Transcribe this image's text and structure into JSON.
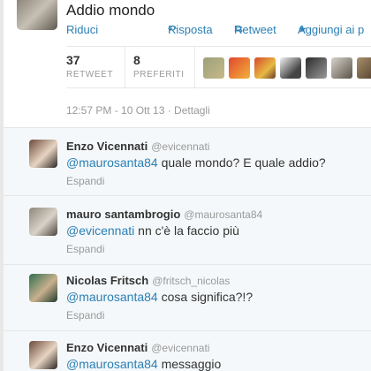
{
  "main_tweet": {
    "text": "Addio mondo",
    "actions": {
      "collapse": "Riduci",
      "reply": "Risposta",
      "retweet": "Retweet",
      "favorite": "Aggiungi ai p"
    },
    "stats": {
      "retweets": {
        "count": "37",
        "label": "RETWEET"
      },
      "favorites": {
        "count": "8",
        "label": "PREFERITI"
      }
    },
    "timestamp": "12:57 PM - 10 Ott 13 · Dettagli"
  },
  "replies": [
    {
      "name": "Enzo Vicennati",
      "handle": "@evicennati",
      "mention": "@maurosanta84",
      "text": " quale mondo? E quale addio?",
      "expand": "Espandi"
    },
    {
      "name": "mauro santambrogio",
      "handle": "@maurosanta84",
      "mention": "@evicennati",
      "text": " nn c'è la faccio più",
      "expand": "Espandi"
    },
    {
      "name": "Nicolas Fritsch",
      "handle": "@fritsch_nicolas",
      "mention": "@maurosanta84",
      "text": " cosa significa?!?",
      "expand": "Espandi"
    },
    {
      "name": "Enzo Vicennati",
      "handle": "@evicennati",
      "mention": "@maurosanta84",
      "text": " messaggio",
      "expand": ""
    }
  ],
  "colors": {
    "link": "#2a7fb5",
    "muted": "#999999",
    "reply_bg": "#f5f8fa"
  }
}
